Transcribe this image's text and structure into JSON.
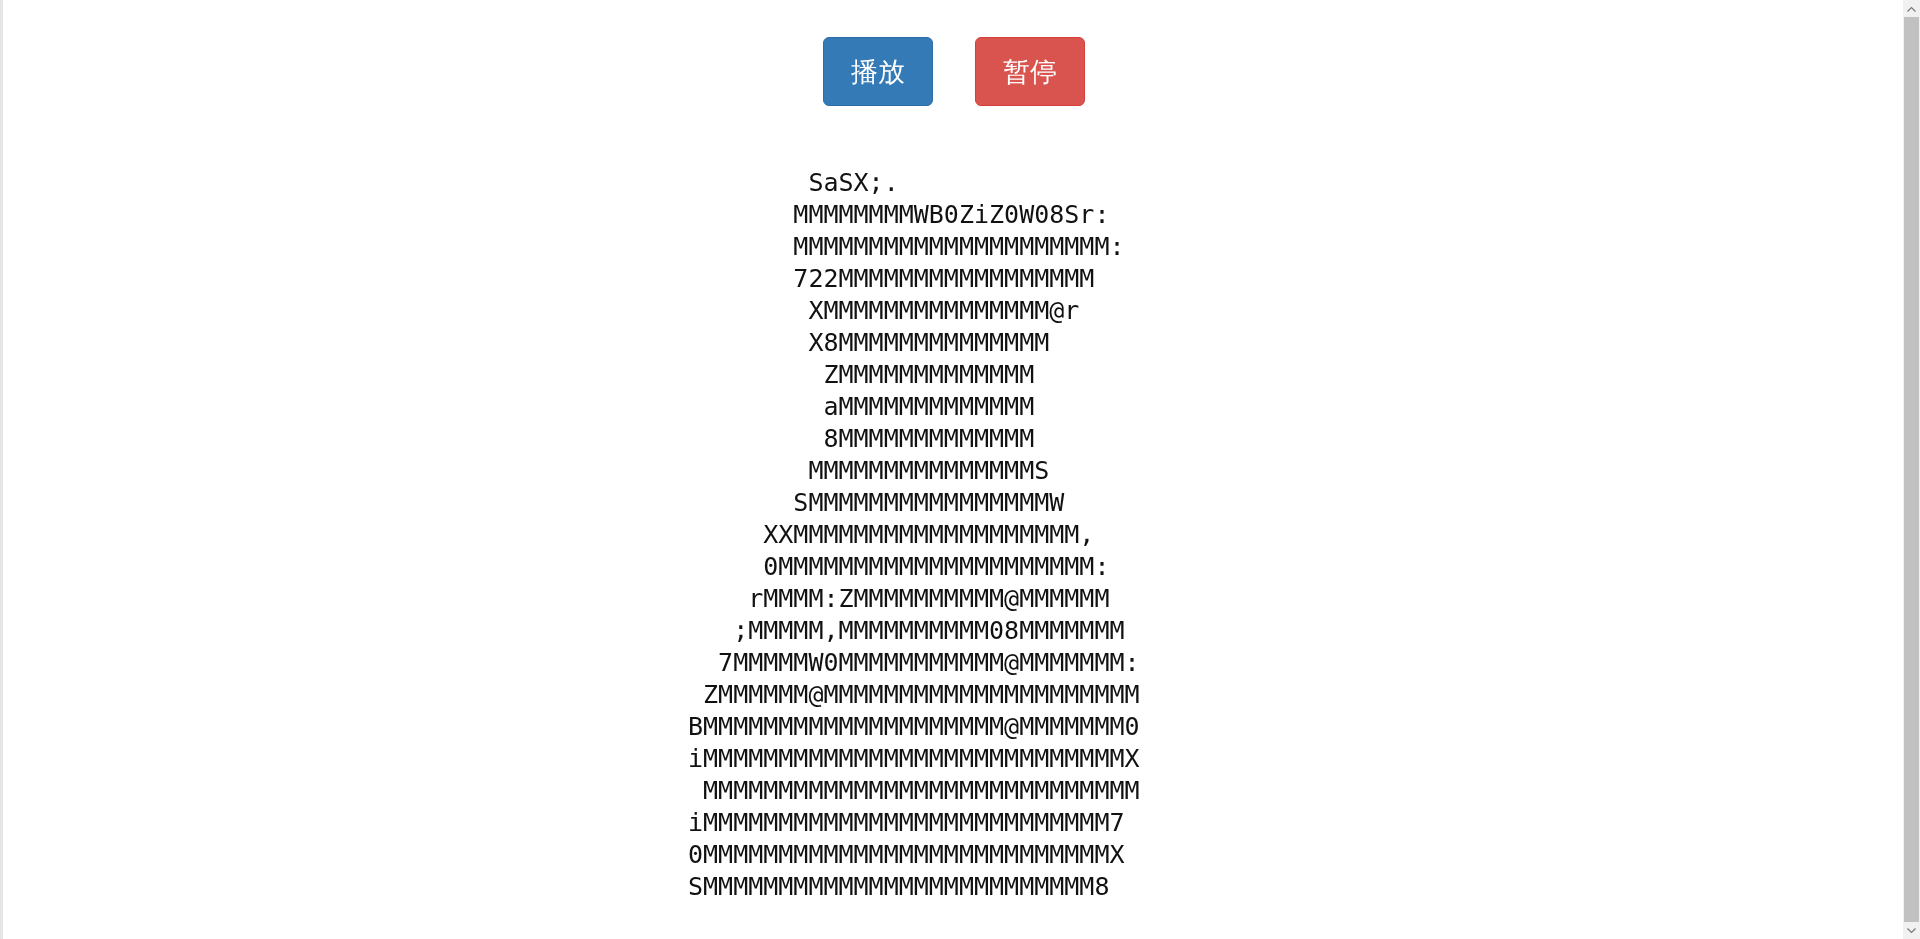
{
  "buttons": [
    {
      "label": "播放",
      "kind": "play"
    },
    {
      "label": "暂停",
      "kind": "pause"
    }
  ],
  "ascii_art": {
    "lines": [
      "        SaSX;.",
      "       MMMMMMMMWB0ZiZ0W08Sr:",
      "       MMMMMMMMMMMMMMMMMMMMM:",
      "       722MMMMMMMMMMMMMMMMM",
      "        XMMMMMMMMMMMMMMM@r",
      "        X8MMMMMMMMMMMMMM",
      "         ZMMMMMMMMMMMMM",
      "         aMMMMMMMMMMMMM",
      "         8MMMMMMMMMMMMM",
      "        MMMMMMMMMMMMMMMS",
      "       SMMMMMMMMMMMMMMMMW",
      "     XXMMMMMMMMMMMMMMMMMMM,",
      "     0MMMMMMMMMMMMMMMMMMMMM:",
      "    rMMMM:ZMMMMMMMMMM@MMMMMM",
      "   ;MMMMM,MMMMMMMMMM08MMMMMMM",
      "  7MMMMMW0MMMMMMMMMMM@MMMMMMM:",
      " ZMMMMMM@MMMMMMMMMMMMMMMMMMMMM",
      "BMMMMMMMMMMMMMMMMMMMM@MMMMMMM0",
      "iMMMMMMMMMMMMMMMMMMMMMMMMMMMMX",
      " MMMMMMMMMMMMMMMMMMMMMMMMMMMMM",
      "iMMMMMMMMMMMMMMMMMMMMMMMMMMM7",
      "0MMMMMMMMMMMMMMMMMMMMMMMMMMMX",
      "SMMMMMMMMMMMMMMMMMMMMMMMMMM8"
    ]
  }
}
